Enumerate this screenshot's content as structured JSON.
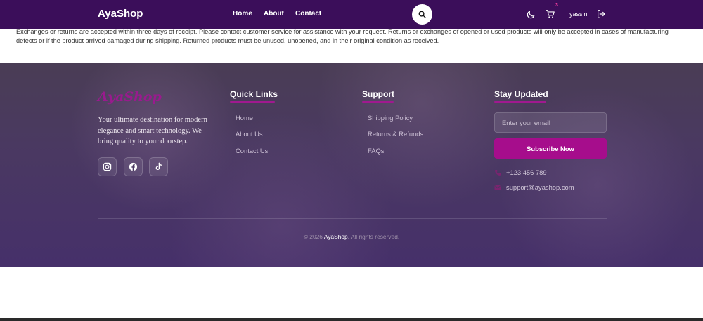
{
  "navbar": {
    "brand": "AyaShop",
    "links": [
      "Home",
      "About",
      "Contact"
    ],
    "cart_count": "3",
    "username": "yassin"
  },
  "policy": {
    "text": "Exchanges or returns are accepted within three days of receipt. Please contact customer service for assistance with your request. Returns or exchanges of opened or used products will only be accepted in cases of manufacturing defects or if the product arrived damaged during shipping. Returned products must be unused, unopened, and in their original condition as received."
  },
  "footer": {
    "logo": "AyaShop",
    "tagline": "Your ultimate destination for modern elegance and smart technology. We bring quality to your doorstep.",
    "social": [
      "instagram-icon",
      "facebook-icon",
      "tiktok-icon"
    ],
    "quick_links": {
      "title": "Quick Links",
      "items": [
        "Home",
        "About Us",
        "Contact Us"
      ]
    },
    "support": {
      "title": "Support",
      "items": [
        "Shipping Policy",
        "Returns & Refunds",
        "FAQs"
      ]
    },
    "stay_updated": {
      "title": "Stay Updated",
      "email_placeholder": "Enter your email",
      "subscribe_label": "Subscribe Now",
      "phone": "+123 456 789",
      "email": "support@ayashop.com"
    },
    "copyright": {
      "prefix": "© 2026",
      "brand": "AyaShop",
      "suffix": ". All rights reserved."
    }
  },
  "colors": {
    "navbar_bg": "#3b0e5a",
    "accent": "#a60d8c",
    "cart_badge": "#ff3fa4"
  }
}
